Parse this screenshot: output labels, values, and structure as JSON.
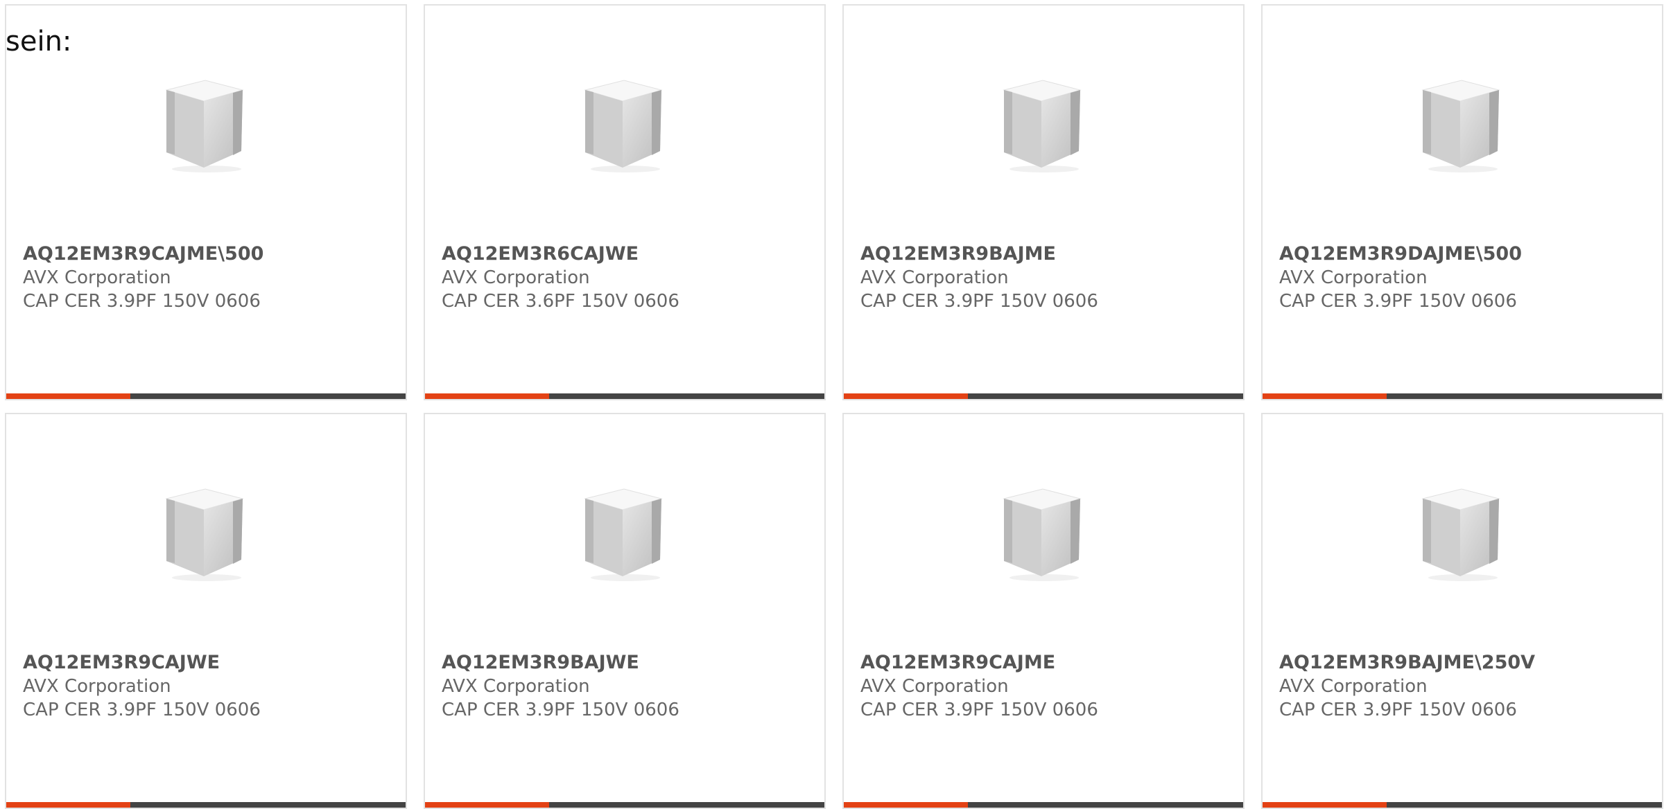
{
  "intro_text": "sein:",
  "accent_color": "#e34215",
  "bar_color": "#444444",
  "cards": [
    {
      "part": "AQ12EM3R9CAJME\\500",
      "manufacturer": "AVX Corporation",
      "description": "CAP CER 3.9PF 150V 0606",
      "thumbnail": "ceramic-capacitor-icon",
      "bar_progress": 0.31
    },
    {
      "part": "AQ12EM3R6CAJWE",
      "manufacturer": "AVX Corporation",
      "description": "CAP CER 3.6PF 150V 0606",
      "thumbnail": "ceramic-capacitor-icon",
      "bar_progress": 0.31
    },
    {
      "part": "AQ12EM3R9BAJME",
      "manufacturer": "AVX Corporation",
      "description": "CAP CER 3.9PF 150V 0606",
      "thumbnail": "ceramic-capacitor-icon",
      "bar_progress": 0.31
    },
    {
      "part": "AQ12EM3R9DAJME\\500",
      "manufacturer": "AVX Corporation",
      "description": "CAP CER 3.9PF 150V 0606",
      "thumbnail": "ceramic-capacitor-icon",
      "bar_progress": 0.31
    },
    {
      "part": "AQ12EM3R9CAJWE",
      "manufacturer": "AVX Corporation",
      "description": "CAP CER 3.9PF 150V 0606",
      "thumbnail": "ceramic-capacitor-icon",
      "bar_progress": 0.31
    },
    {
      "part": "AQ12EM3R9BAJWE",
      "manufacturer": "AVX Corporation",
      "description": "CAP CER 3.9PF 150V 0606",
      "thumbnail": "ceramic-capacitor-icon",
      "bar_progress": 0.31
    },
    {
      "part": "AQ12EM3R9CAJME",
      "manufacturer": "AVX Corporation",
      "description": "CAP CER 3.9PF 150V 0606",
      "thumbnail": "ceramic-capacitor-icon",
      "bar_progress": 0.31
    },
    {
      "part": "AQ12EM3R9BAJME\\250V",
      "manufacturer": "AVX Corporation",
      "description": "CAP CER 3.9PF 150V 0606",
      "thumbnail": "ceramic-capacitor-icon",
      "bar_progress": 0.31
    }
  ]
}
